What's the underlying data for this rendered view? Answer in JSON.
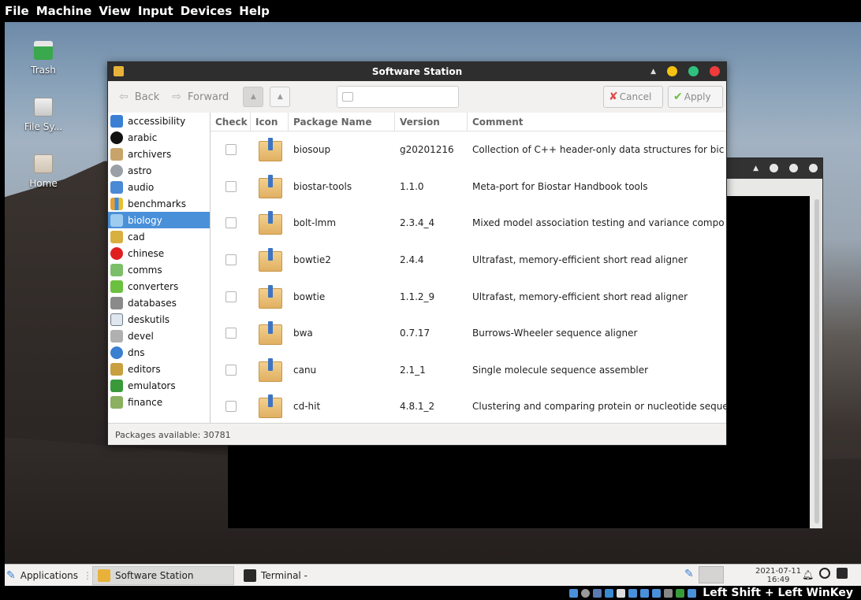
{
  "vm_menu": [
    "File",
    "Machine",
    "View",
    "Input",
    "Devices",
    "Help"
  ],
  "desktop_icons": [
    {
      "label": "Trash"
    },
    {
      "label": "File Sy..."
    },
    {
      "label": "Home"
    }
  ],
  "window": {
    "title": "Software Station",
    "toolbar": {
      "back_label": "Back",
      "forward_label": "Forward",
      "search_placeholder": "",
      "cancel_label": "Cancel",
      "apply_label": "Apply"
    },
    "categories": [
      {
        "label": "accessibility",
        "selected": false
      },
      {
        "label": "arabic",
        "selected": false
      },
      {
        "label": "archivers",
        "selected": false
      },
      {
        "label": "astro",
        "selected": false
      },
      {
        "label": "audio",
        "selected": false
      },
      {
        "label": "benchmarks",
        "selected": false
      },
      {
        "label": "biology",
        "selected": true
      },
      {
        "label": "cad",
        "selected": false
      },
      {
        "label": "chinese",
        "selected": false
      },
      {
        "label": "comms",
        "selected": false
      },
      {
        "label": "converters",
        "selected": false
      },
      {
        "label": "databases",
        "selected": false
      },
      {
        "label": "deskutils",
        "selected": false
      },
      {
        "label": "devel",
        "selected": false
      },
      {
        "label": "dns",
        "selected": false
      },
      {
        "label": "editors",
        "selected": false
      },
      {
        "label": "emulators",
        "selected": false
      },
      {
        "label": "finance",
        "selected": false
      }
    ],
    "columns": {
      "check": "Check",
      "icon": "Icon",
      "name": "Package Name",
      "version": "Version",
      "comment": "Comment"
    },
    "packages": [
      {
        "name": "biosoup",
        "version": "g20201216",
        "comment": "Collection of C++ header-only data structures for bic",
        "checked": false
      },
      {
        "name": "biostar-tools",
        "version": "1.1.0",
        "comment": "Meta-port for Biostar Handbook tools",
        "checked": false
      },
      {
        "name": "bolt-lmm",
        "version": "2.3.4_4",
        "comment": "Mixed model association testing and variance compo",
        "checked": false
      },
      {
        "name": "bowtie2",
        "version": "2.4.4",
        "comment": "Ultrafast, memory-efficient short read aligner",
        "checked": false
      },
      {
        "name": "bowtie",
        "version": "1.1.2_9",
        "comment": "Ultrafast, memory-efficient short read aligner",
        "checked": false
      },
      {
        "name": "bwa",
        "version": "0.7.17",
        "comment": "Burrows-Wheeler sequence aligner",
        "checked": false
      },
      {
        "name": "canu",
        "version": "2.1_1",
        "comment": "Single molecule sequence assembler",
        "checked": false
      },
      {
        "name": "cd-hit",
        "version": "4.8.1_2",
        "comment": "Clustering and comparing protein or nucleotide seque",
        "checked": false
      }
    ],
    "status": "Packages available: 30781"
  },
  "taskbar": {
    "applications_label": "Applications",
    "items": [
      {
        "label": "Software Station"
      },
      {
        "label": "Terminal -"
      }
    ],
    "date": "2021-07-11",
    "time": "16:49"
  },
  "host_status": "Left Shift + Left WinKey",
  "colors": {
    "selection": "#4a90d9",
    "close_dot": "#ef3b3b",
    "maximize_dot": "#2ec27e",
    "minimize_dot": "#f5c211"
  }
}
